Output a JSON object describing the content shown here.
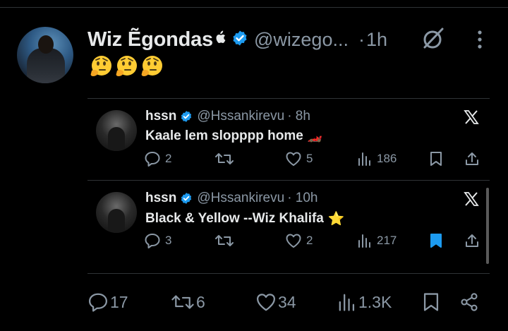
{
  "post": {
    "author_name": "Wiz Ẽgondas",
    "author_handle": "@wizego...",
    "separator": "·",
    "time": "1h",
    "icons": {
      "apple": "apple-logo-icon",
      "verified": "verified-badge-icon",
      "grok": "grok-icon",
      "more": "more-vertical-icon"
    },
    "emojis": [
      "🤔",
      "🤔",
      "🤔"
    ],
    "stats": {
      "replies": "17",
      "reposts": "6",
      "likes": "34",
      "views": "1.3K"
    }
  },
  "quotes": [
    {
      "name": "hssn",
      "handle": "@Hssankirevu",
      "time": "· 8h",
      "text": "Kaale lem slopppp home",
      "text_emoji": "🏎️",
      "replies": "2",
      "likes": "5",
      "views": "186",
      "bookmarked": false
    },
    {
      "name": "hssn",
      "handle": "@Hssankirevu",
      "time": "· 10h",
      "text": "Black & Yellow --Wiz Khalifa",
      "text_emoji": "⭐",
      "replies": "3",
      "likes": "2",
      "views": "217",
      "bookmarked": true
    }
  ],
  "colors": {
    "background": "#000000",
    "text": "#e7e9ea",
    "muted": "#8b98a5",
    "accent": "#1d9bf0",
    "divider": "#2f3336"
  }
}
